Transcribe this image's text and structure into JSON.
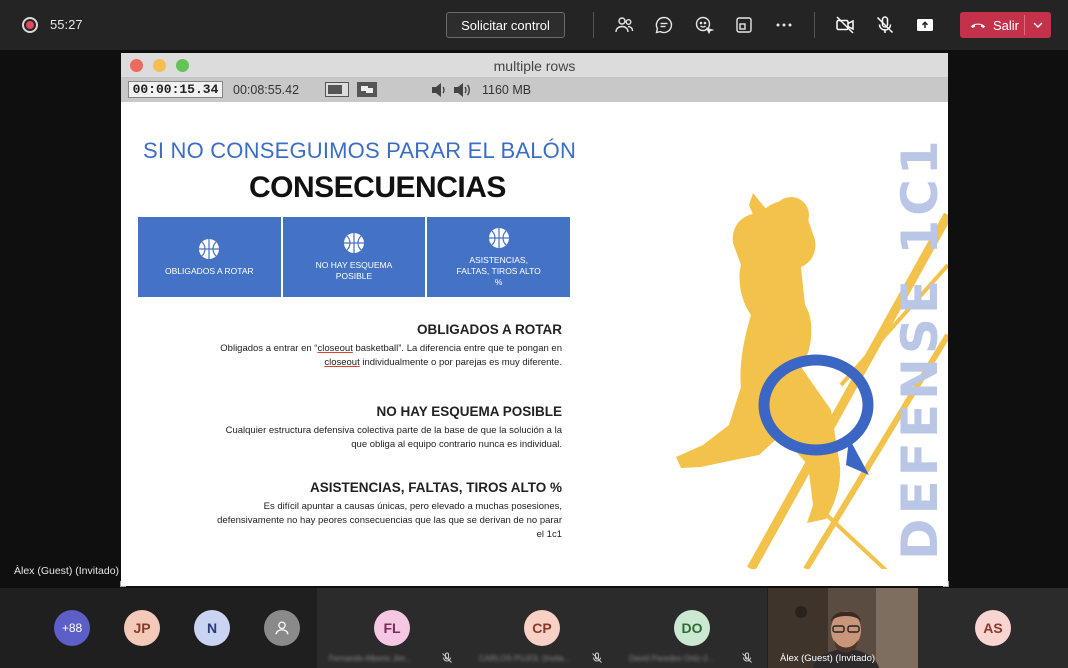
{
  "topbar": {
    "timer": "55:27",
    "request_control": "Solicitar control",
    "leave_label": "Salir",
    "icons": [
      "people-icon",
      "chat-icon",
      "reactions-icon",
      "rooms-icon",
      "more-icon",
      "camera-off-icon",
      "mic-off-icon",
      "share-icon"
    ]
  },
  "shared_window": {
    "title": "multiple rows",
    "timecode": "00:00:15.34",
    "duration": "00:08:55.42",
    "memory": "1160 MB"
  },
  "slide": {
    "subtitle": "SI NO CONSEGUIMOS PARAR EL BALÓN",
    "title": "CONSECUENCIAS",
    "cards": [
      {
        "label": "OBLIGADOS A ROTAR"
      },
      {
        "label": "NO HAY ESQUEMA POSIBLE"
      },
      {
        "label": "ASISTENCIAS, FALTAS, TIROS ALTO %"
      }
    ],
    "sections": [
      {
        "heading": "OBLIGADOS A ROTAR",
        "line1a": "Obligados a entrar en “",
        "line1u": "closeout",
        "line1b": " basketball”. La diferencia entre que te pongan en",
        "line2u": "closeout",
        "line2b": " individualmente o por parejas es muy diferente."
      },
      {
        "heading": "NO HAY ESQUEMA POSIBLE",
        "line1": "Cualquier estructura defensiva colectiva parte de la base de que la solución a la",
        "line2": "que obliga al equipo contrario nunca es individual."
      },
      {
        "heading": "ASISTENCIAS, FALTAS, TIROS ALTO %",
        "line1": "Es difícil apuntar a causas únicas, pero elevado a muchas posesiones,",
        "line2": "defensivamente no hay peores consecuencias que las que se derivan de no parar",
        "line3": "el 1c1"
      }
    ],
    "vertical_text": "DEFENSE 1C1"
  },
  "presenter_label": "Àlex (Guest) (Invitado)",
  "participants": {
    "overflow": "+88",
    "avatars": [
      {
        "initials": "JP",
        "color": "#f3c9b9"
      },
      {
        "initials": "N",
        "color": "#c9d3f2"
      },
      {
        "initials": "",
        "color": "#8a8a8a"
      }
    ],
    "tiles": [
      {
        "initials": "FL",
        "color": "#f5c7e3",
        "name": "Fernando Alberto Jim..."
      },
      {
        "initials": "CP",
        "color": "#f9d0c4",
        "name": "CARLOS PUJOL (Invita..."
      },
      {
        "initials": "DO",
        "color": "#cbe9d0",
        "name": "David Paredes Ortiz (I..."
      }
    ],
    "video_name": "Àlex (Guest) (Invitado)",
    "last": {
      "initials": "AS",
      "color": "#f9d4d0"
    }
  }
}
